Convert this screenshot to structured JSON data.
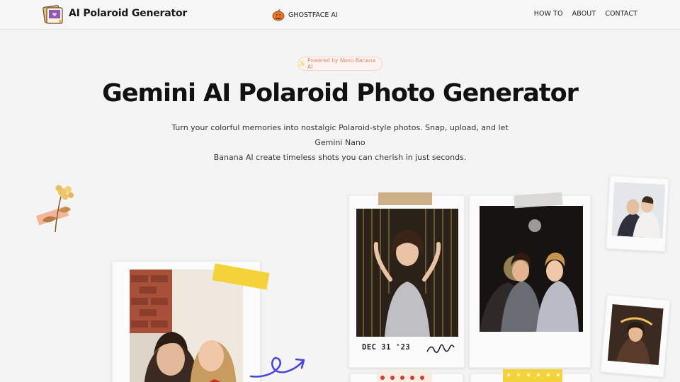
{
  "header": {
    "logo_text": "AI Polaroid Generator",
    "ghostface_label": "GHOSTFACE AI",
    "nav": [
      {
        "label": "HOW TO"
      },
      {
        "label": "ABOUT"
      },
      {
        "label": "CONTACT"
      }
    ]
  },
  "hero": {
    "badge_icon": "✨",
    "badge_text": "Powered by Nano Banana AI",
    "title": "Gemini AI Polaroid Photo Generator",
    "subtitle_line1": "Turn your colorful memories into nostalgic Polaroid-style photos. Snap, upload, and let Gemini Nano",
    "subtitle_line2": "Banana AI create timeless shots you can cherish in just seconds."
  },
  "photos": {
    "party_caption": "DEC 31 '23"
  },
  "colors": {
    "accent_badge": "#d98a6b",
    "tape_yellow": "#f6d23a",
    "tape_tan": "#c9a77a",
    "swirl": "#4b47d6"
  },
  "icons": {
    "logo": "polaroid-stack-icon",
    "ghostface": "pumpkin-icon",
    "flower": "dried-flower-icon",
    "swirl": "swirl-arrow-icon"
  }
}
